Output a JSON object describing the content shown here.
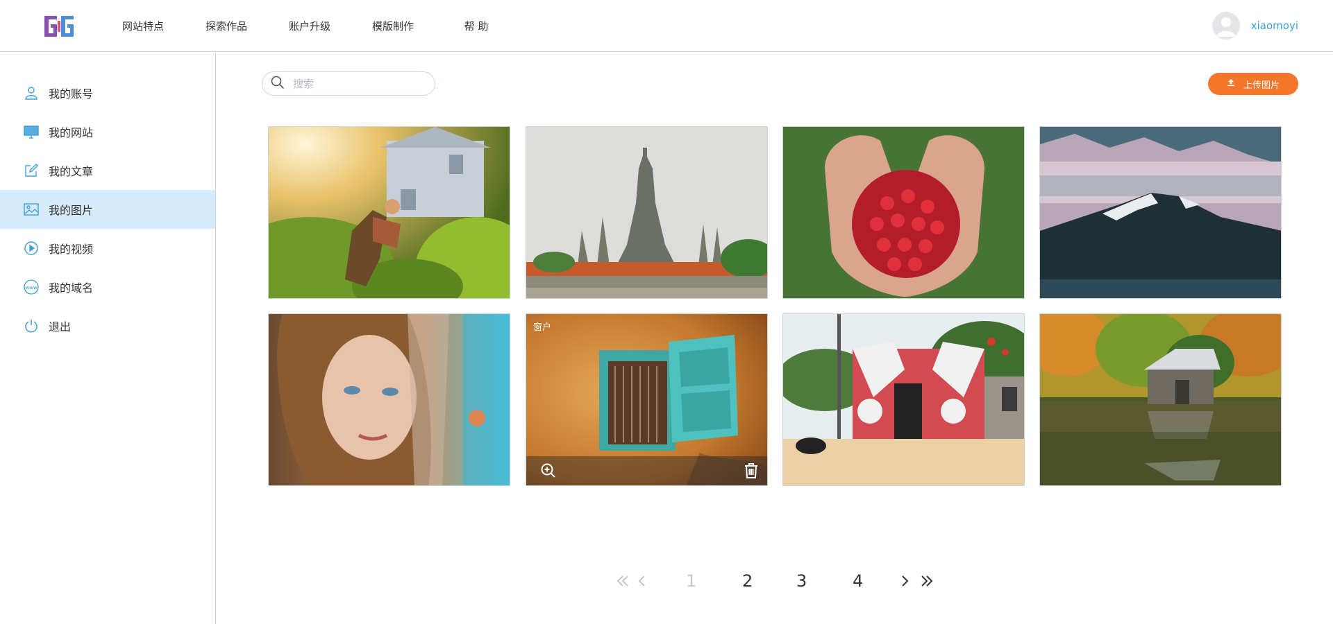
{
  "header": {
    "nav": [
      "网站特点",
      "探索作品",
      "账户升级",
      "模版制作",
      "帮 助"
    ],
    "username": "xiaomoyi"
  },
  "sidebar": {
    "items": [
      {
        "label": "我的账号",
        "icon": "user-icon"
      },
      {
        "label": "我的网站",
        "icon": "monitor-icon"
      },
      {
        "label": "我的文章",
        "icon": "edit-icon"
      },
      {
        "label": "我的图片",
        "icon": "image-icon",
        "active": true
      },
      {
        "label": "我的视频",
        "icon": "play-icon"
      },
      {
        "label": "我的域名",
        "icon": "www-icon"
      },
      {
        "label": "退出",
        "icon": "power-icon"
      }
    ]
  },
  "toolbar": {
    "search_placeholder": "搜索",
    "upload_label": "上传图片"
  },
  "gallery": {
    "hover_card_title": "窗户",
    "images": [
      {
        "subject": "woman-gardening"
      },
      {
        "subject": "temple"
      },
      {
        "subject": "raspberries-in-hands"
      },
      {
        "subject": "mountain-lake"
      },
      {
        "subject": "woman-portrait"
      },
      {
        "subject": "window"
      },
      {
        "subject": "painted-house"
      },
      {
        "subject": "lake-boathouse"
      }
    ]
  },
  "pagination": {
    "pages": [
      "1",
      "2",
      "3",
      "4"
    ],
    "current": "1"
  },
  "colors": {
    "accent": "#3aa0d9",
    "upload": "#f4762b",
    "active_bg": "#d6ebfb"
  }
}
